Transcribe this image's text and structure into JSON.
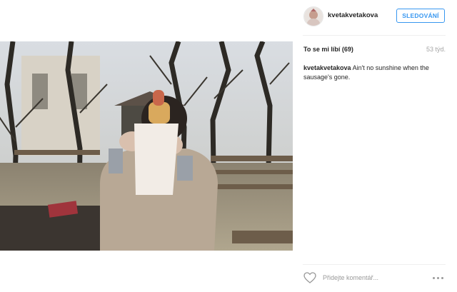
{
  "post": {
    "image_icon": "photo-woman-eating-sausage-icon"
  },
  "header": {
    "username": "kvetakvetakova",
    "follow_label": "SLEDOVÁNÍ",
    "avatar_icon": "avatar-icon"
  },
  "stats": {
    "likes_label": "To se mi líbí (69)",
    "time_ago": "53 týd."
  },
  "caption": {
    "username": "kvetakvetakova",
    "text": " Ain't no sunshine when the sausage's gone."
  },
  "comment": {
    "placeholder": "Přidejte komentář...",
    "like_icon": "heart-icon",
    "more_icon": "more-options-icon"
  },
  "colors": {
    "accent": "#3897f0",
    "text": "#262626",
    "muted": "#999999"
  }
}
